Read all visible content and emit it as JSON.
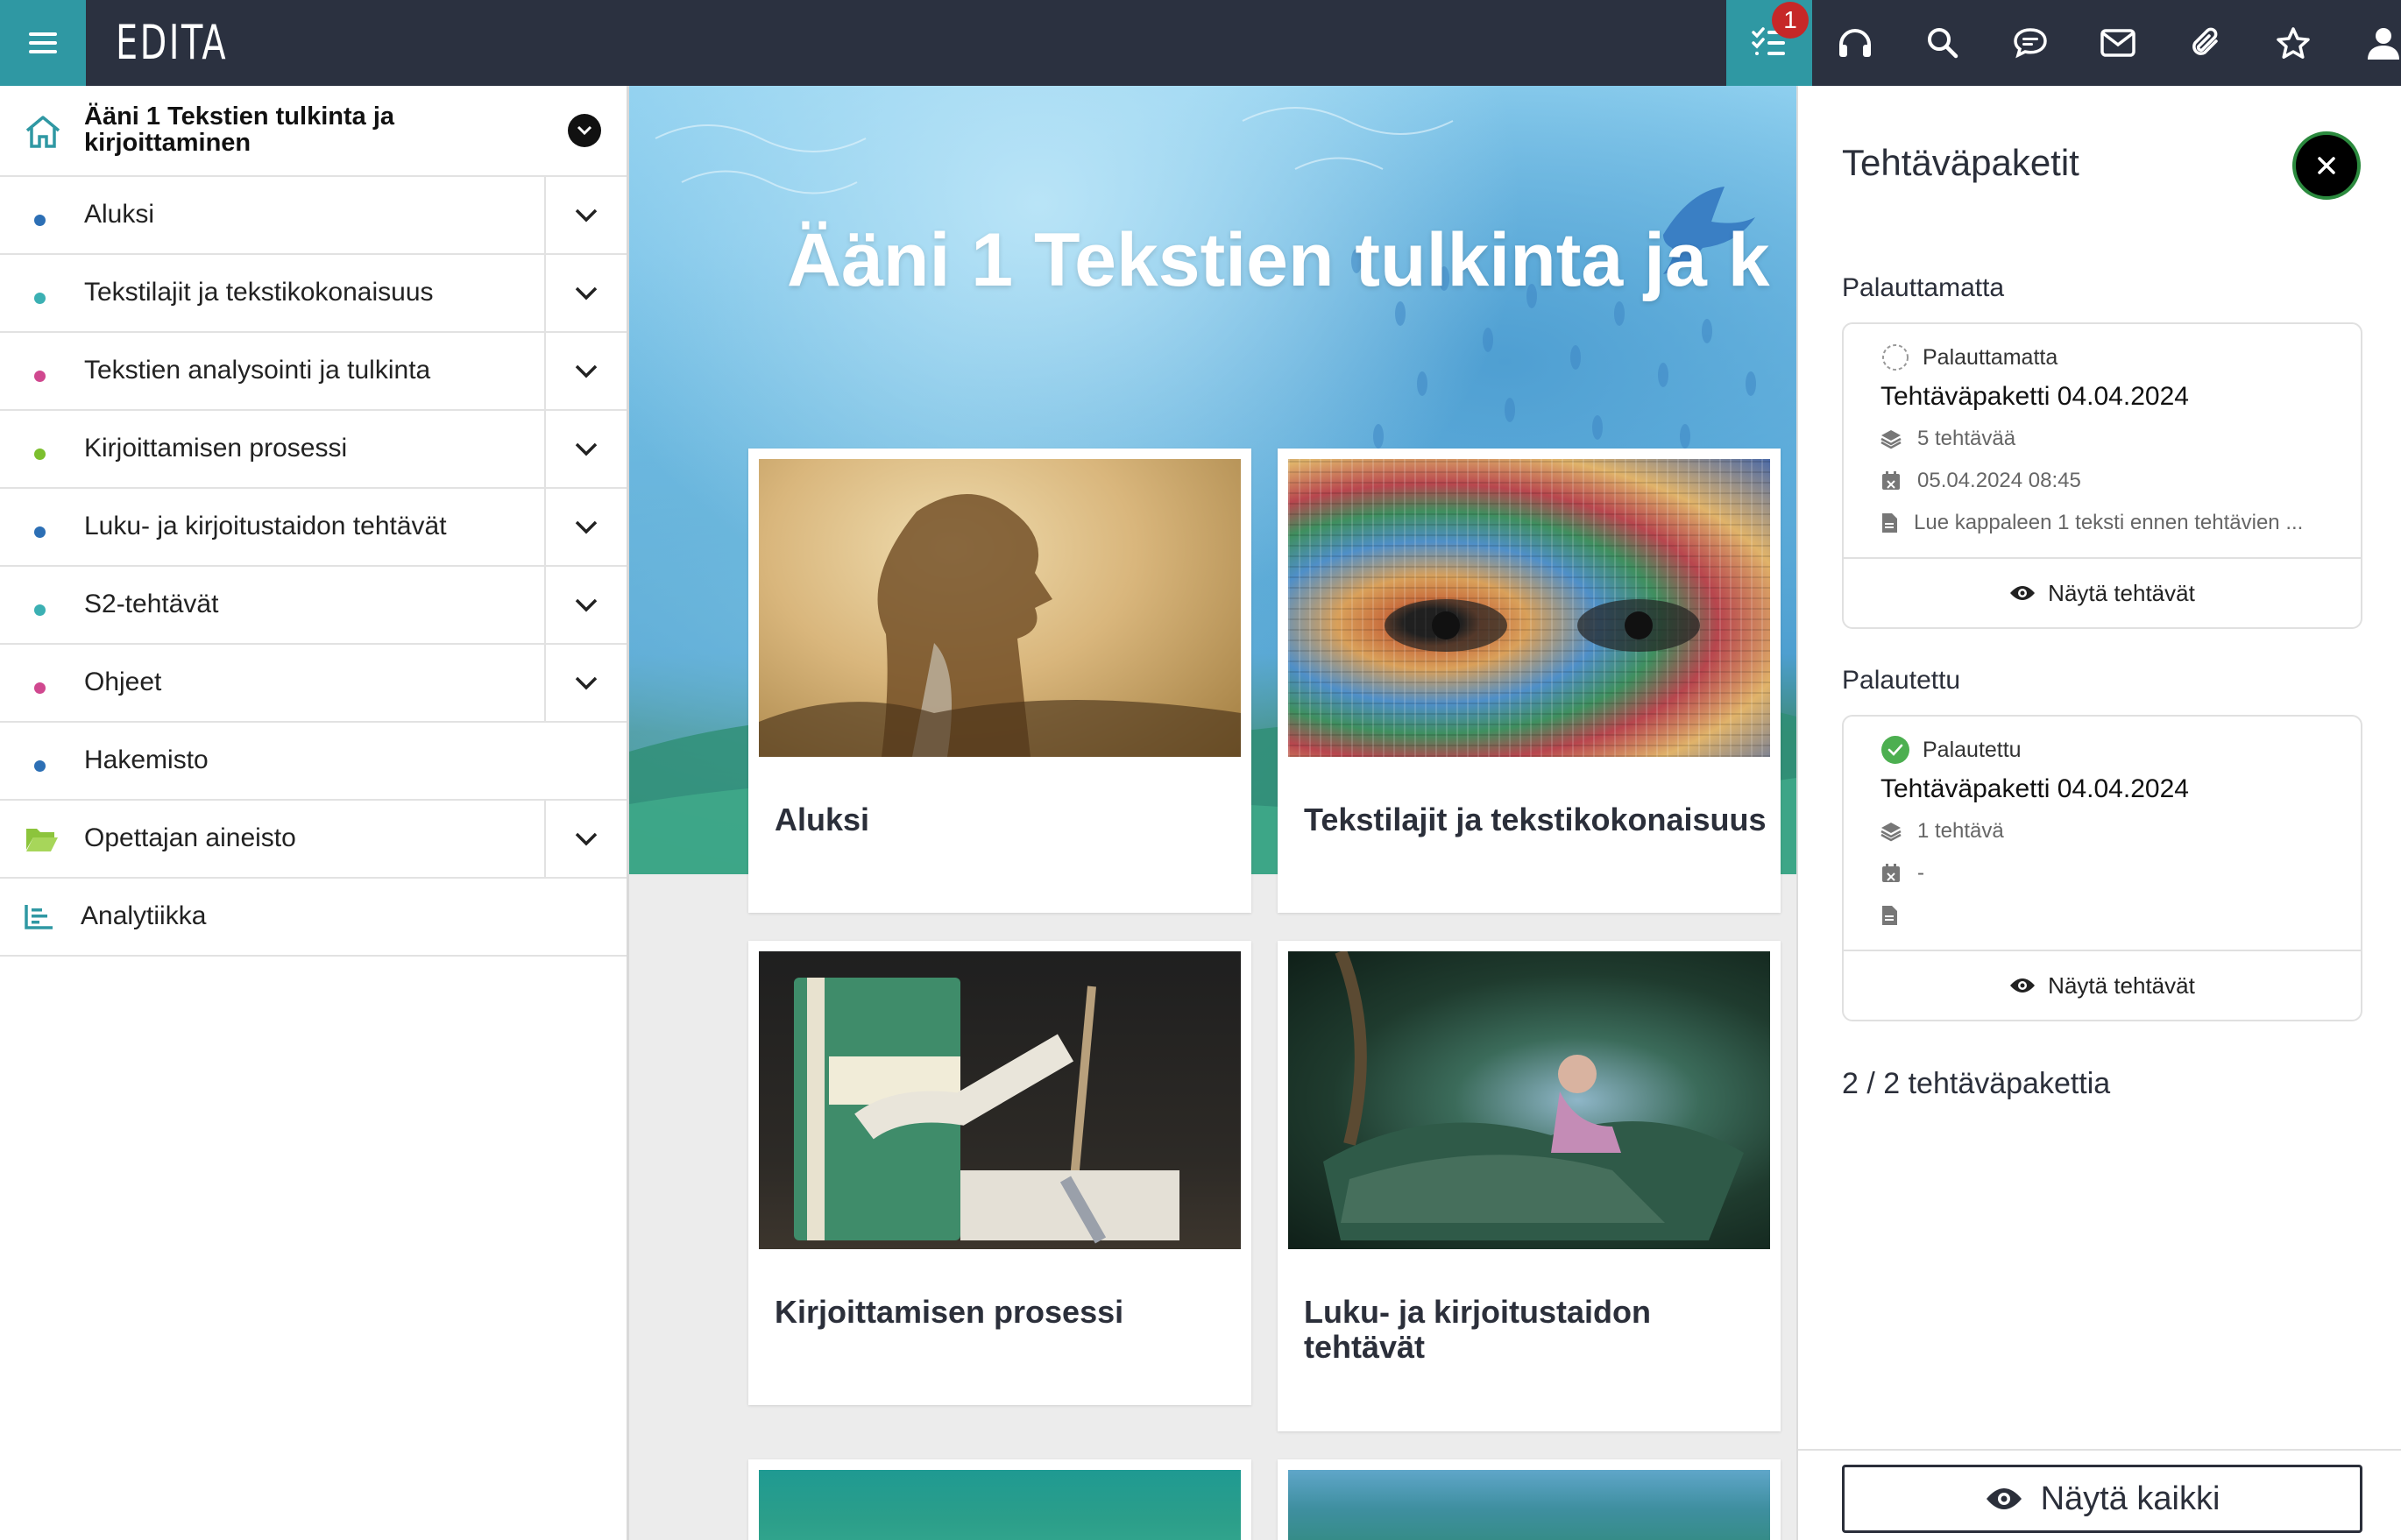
{
  "app": {
    "logo": "EDITA",
    "notification_count": "1"
  },
  "topbar": {
    "icons": [
      "menu-icon",
      "task-list-icon",
      "headphones-icon",
      "search-icon",
      "chat-icon",
      "mail-icon",
      "attachment-icon",
      "star-icon",
      "user-icon"
    ]
  },
  "sidebar": {
    "title": "Ääni 1 Tekstien tulkinta ja kirjoittaminen",
    "items": [
      {
        "label": "Aluksi",
        "dot": "#2c6fb5"
      },
      {
        "label": "Tekstilajit ja tekstikokonaisuus",
        "dot": "#3bb0b3"
      },
      {
        "label": "Tekstien analysointi ja tulkinta",
        "dot": "#d0488f"
      },
      {
        "label": "Kirjoittamisen prosessi",
        "dot": "#7cbf2e"
      },
      {
        "label": "Luku- ja kirjoitustaidon tehtävät",
        "dot": "#2c6fb5"
      },
      {
        "label": "S2-tehtävät",
        "dot": "#3bb0b3"
      },
      {
        "label": "Ohjeet",
        "dot": "#d0488f"
      },
      {
        "label": "Hakemisto",
        "dot": "#2c6fb5"
      },
      {
        "label": "Opettajan aineisto"
      },
      {
        "label": "Analytiikka"
      }
    ]
  },
  "main": {
    "hero_title": "Ääni 1 Tekstien tulkinta ja k",
    "cards": [
      {
        "title": "Aluksi"
      },
      {
        "title": "Tekstilajit ja tekstikokonaisuus"
      },
      {
        "title": "Kirjoittamisen prosessi"
      },
      {
        "title": "Luku- ja kirjoitustaidon tehtävät"
      }
    ]
  },
  "panel": {
    "title": "Tehtäväpaketit",
    "section_pending": "Palauttamatta",
    "section_returned": "Palautettu",
    "pending": {
      "status": "Palauttamatta",
      "name": "Tehtäväpaketti 04.04.2024",
      "tasks": "5 tehtävää",
      "date": "05.04.2024 08:45",
      "description": "Lue kappaleen 1 teksti ennen tehtävien ...",
      "show_label": "Näytä tehtävät"
    },
    "returned": {
      "status": "Palautettu",
      "name": "Tehtäväpaketti 04.04.2024",
      "tasks": "1 tehtävä",
      "date": "-",
      "description": "",
      "show_label": "Näytä tehtävät"
    },
    "count_text": "2 / 2 tehtäväpakettia",
    "show_all_label": "Näytä kaikki"
  },
  "colors": {
    "topbar": "#2b3140",
    "accent": "#2f98a3",
    "badge": "#c62828",
    "success": "#4caf50"
  }
}
